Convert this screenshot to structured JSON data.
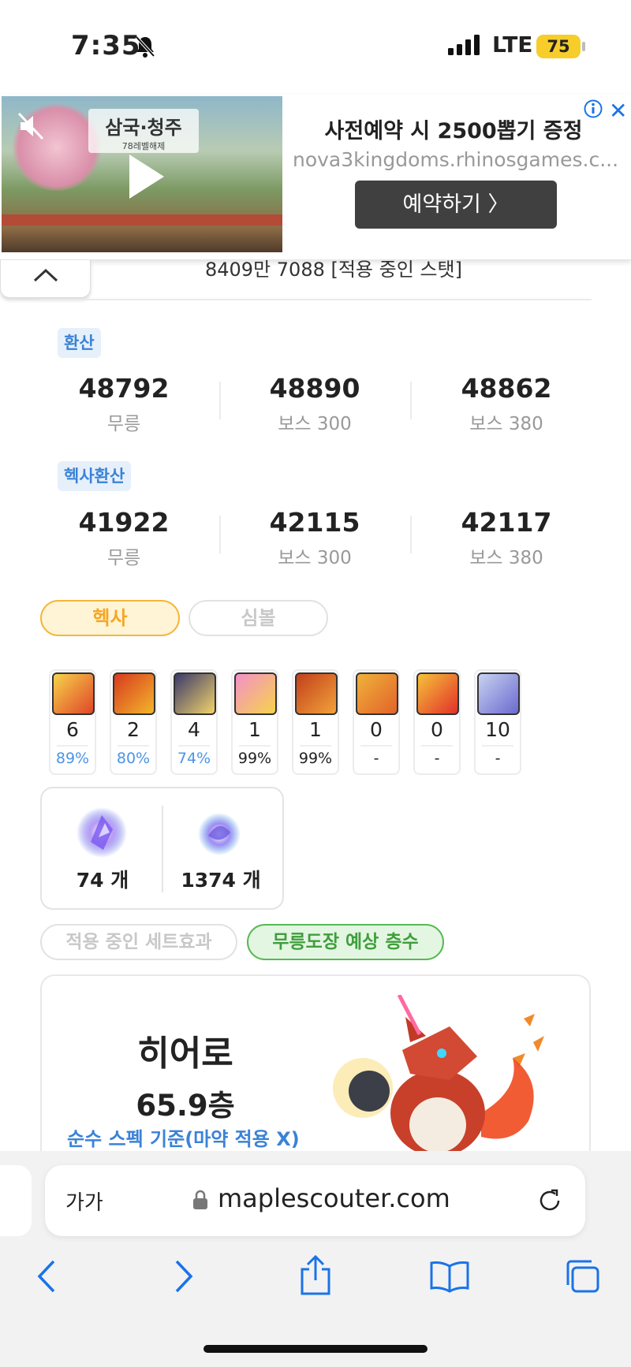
{
  "status_bar": {
    "time": "7:35",
    "network": "LTE",
    "battery": "75"
  },
  "ad": {
    "game_title": "삼국·청주",
    "game_subtitle": "78레벨해제",
    "headline": "사전예약 시 2500뽑기 증정",
    "url": "nova3kingdoms.rhinosgames.c...",
    "cta_label": "예약하기 〉"
  },
  "cut_off": {
    "left_text": "̄ᆨ",
    "right_text": "8409만 7088  [적용 중인 스탯]"
  },
  "sections": [
    {
      "tag": "환산",
      "stats": [
        {
          "value": "48792",
          "label": "무릉"
        },
        {
          "value": "48890",
          "label": "보스 300"
        },
        {
          "value": "48862",
          "label": "보스 380"
        }
      ]
    },
    {
      "tag": "헥사환산",
      "stats": [
        {
          "value": "41922",
          "label": "무릉"
        },
        {
          "value": "42115",
          "label": "보스 300"
        },
        {
          "value": "42117",
          "label": "보스 380"
        }
      ]
    }
  ],
  "tabs": {
    "hexa": "헥사",
    "symbol": "심볼"
  },
  "skills": [
    {
      "level": "6",
      "pct": "89%",
      "pct_color": "#4b95e6",
      "icon_colors": [
        "#f6d34a",
        "#e0452a"
      ]
    },
    {
      "level": "2",
      "pct": "80%",
      "pct_color": "#4b95e6",
      "icon_colors": [
        "#d83a1e",
        "#f2b62c"
      ]
    },
    {
      "level": "4",
      "pct": "74%",
      "pct_color": "#4b95e6",
      "icon_colors": [
        "#3a3a6a",
        "#f2d36a"
      ]
    },
    {
      "level": "1",
      "pct": "99%",
      "pct_color": "#222222",
      "icon_colors": [
        "#f390c8",
        "#f6d34a"
      ]
    },
    {
      "level": "1",
      "pct": "99%",
      "pct_color": "#222222",
      "icon_colors": [
        "#c2401c",
        "#f2a23a"
      ]
    },
    {
      "level": "0",
      "pct": "-",
      "pct_color": "#222222",
      "icon_colors": [
        "#f0b23a",
        "#e2632a"
      ]
    },
    {
      "level": "0",
      "pct": "-",
      "pct_color": "#222222",
      "icon_colors": [
        "#f6c23a",
        "#e2302a"
      ]
    },
    {
      "level": "10",
      "pct": "-",
      "pct_color": "#222222",
      "icon_colors": [
        "#c8d2f0",
        "#6a6ad0"
      ]
    }
  ],
  "fragments": {
    "sol_erda": "74 개",
    "fragment": "1374 개"
  },
  "subtabs": {
    "set_effect": "적용 중인 세트효과",
    "mureung": "무릉도장 예상 층수"
  },
  "result": {
    "job": "히어로",
    "floor": "65.9층",
    "basis": "순수 스펙 기준(마약 적용 X)"
  },
  "browser": {
    "text_size": "가가",
    "domain": "maplescouter.com"
  }
}
